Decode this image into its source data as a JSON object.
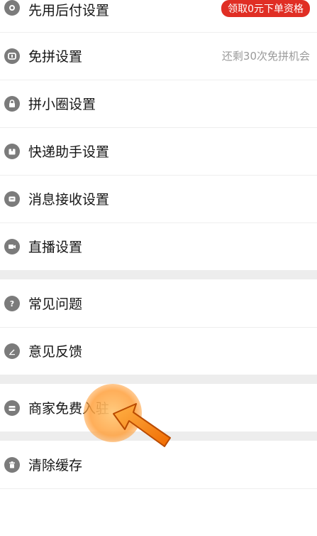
{
  "settings": {
    "items": [
      {
        "label": "先用后付设置",
        "icon": "gear-icon",
        "badge": "领取0元下单资格"
      },
      {
        "label": "免拼设置",
        "icon": "coupon-icon",
        "note": "还剩30次免拼机会"
      },
      {
        "label": "拼小圈设置",
        "icon": "lock-icon"
      },
      {
        "label": "快递助手设置",
        "icon": "package-icon"
      },
      {
        "label": "消息接收设置",
        "icon": "message-icon"
      },
      {
        "label": "直播设置",
        "icon": "video-icon"
      }
    ],
    "help_items": [
      {
        "label": "常见问题",
        "icon": "question-icon"
      },
      {
        "label": "意见反馈",
        "icon": "edit-icon"
      }
    ],
    "merchant_items": [
      {
        "label": "商家免费入驻",
        "icon": "store-icon"
      }
    ],
    "cache_items": [
      {
        "label": "清除缓存",
        "icon": "trash-icon"
      }
    ]
  },
  "colors": {
    "badge_bg": "#e02e24",
    "icon_bg": "#7b7b7b",
    "note_text": "#9a9a9a"
  }
}
